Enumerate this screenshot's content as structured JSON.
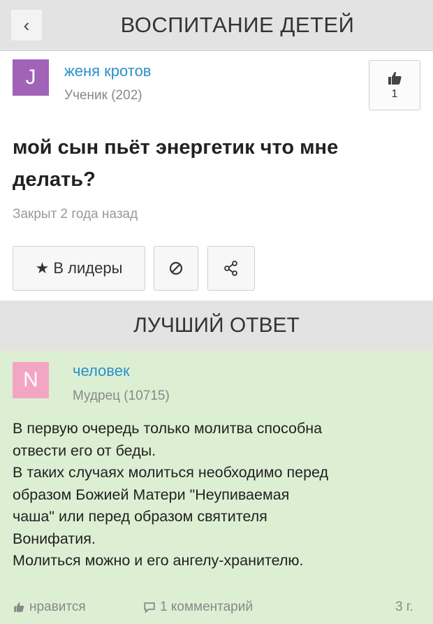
{
  "header": {
    "back_icon": "‹",
    "title": "ВОСПИТАНИЕ ДЕТЕЙ"
  },
  "question_author": {
    "avatar_letter": "J",
    "avatar_color": "#a063b8",
    "name": "женя кротов",
    "rank": "Ученик (202)"
  },
  "like": {
    "icon": "thumbs-up-icon",
    "count": "1"
  },
  "question": {
    "lines": [
      "мой сын пьёт энергетик что мне",
      "делать?"
    ],
    "status": "Закрыт 2 года назад"
  },
  "actions": {
    "leaders_star": "★",
    "leaders_label": "В лидеры",
    "block_icon": "block-icon",
    "share_icon": "share-icon"
  },
  "best_answer": {
    "header": "ЛУЧШИЙ ОТВЕТ",
    "author": {
      "avatar_letter": "N",
      "avatar_color": "#f2a6c2",
      "name": "человек",
      "rank": "Мудрец (10715)"
    },
    "lines": [
      "В первую очередь только молитва способна",
      "отвести его от беды.",
      "В таких случаях молиться необходимо перед",
      "образом Божией Матери \"Неупиваемая",
      "чаша\" или перед образом святителя",
      "Вонифатия.",
      "Молиться можно и его ангелу-хранителю."
    ],
    "like_label": "нравится",
    "comments_label": "1 комментарий",
    "age": "3 г."
  },
  "colors": {
    "accent_link": "#2a90c8",
    "answer_bg": "#dcefd3",
    "bar_bg": "#e3e3e3"
  }
}
